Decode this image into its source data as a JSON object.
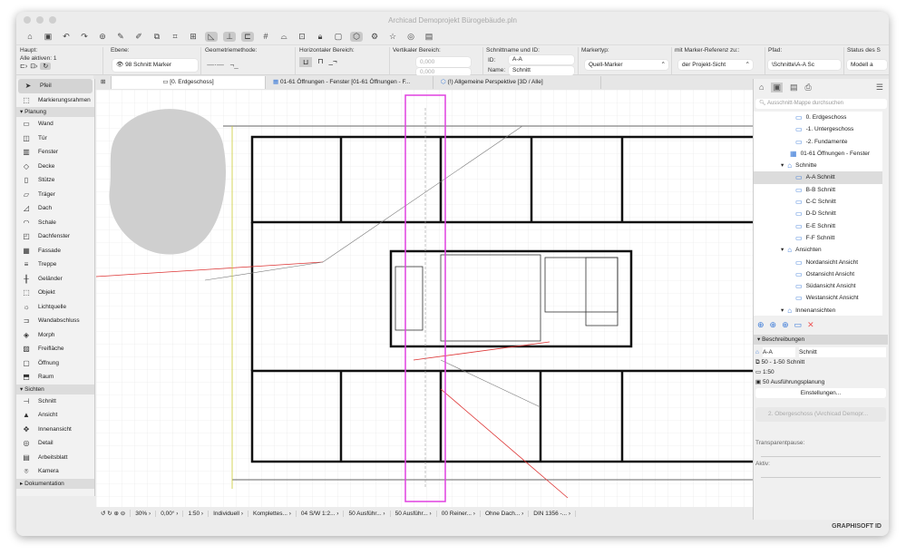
{
  "window": {
    "title": "Archicad Demoprojekt Bürogebäude.pln"
  },
  "infobox": {
    "haupt_label": "Haupt:",
    "alle_aktiven": "Alle aktiven: 1",
    "ebene_label": "Ebene:",
    "ebene_value": "98 Schnitt Marker",
    "geometrie_label": "Geometriemethode:",
    "horizontal_label": "Horizontaler Bereich:",
    "vertikal_label": "Vertikaler Bereich:",
    "vert_value1": "0,000",
    "vert_value2": "0,000",
    "schnitt_label": "Schnittname und ID:",
    "id_label": "ID:",
    "id_value": "A-A",
    "name_label": "Name:",
    "name_value": "Schnitt",
    "markertyp_label": "Markertyp:",
    "markertyp_value": "Quell-Marker",
    "referenz_label": "mit Marker-Referenz zu::",
    "referenz_value": "der Projekt-Sicht",
    "pfad_label": "Pfad:",
    "pfad_value": "\\Schnitte\\A-A Sc",
    "status_label": "Status des S",
    "status_value": "Modell a"
  },
  "tabs": [
    "[0. Erdgeschoss]",
    "01-61 Öffnungen - Fenster [01-61 Öffnungen - F...",
    "(!) Allgemeine Perspektive [3D / Alle]"
  ],
  "toolbox": {
    "tools1": [
      {
        "label": "Pfeil",
        "icon": "arrow"
      },
      {
        "label": "Markierungsrahmen",
        "icon": "marquee"
      }
    ],
    "section1": "Planung",
    "tools2": [
      "Wand",
      "Tür",
      "Fenster",
      "Decke",
      "Stütze",
      "Träger",
      "Dach",
      "Schale",
      "Dachfenster",
      "Fassade",
      "Treppe",
      "Geländer",
      "Objekt",
      "Lichtquelle",
      "Wandabschluss",
      "Morph",
      "Freifläche",
      "Öffnung",
      "Raum"
    ],
    "section2": "Sichten",
    "tools3": [
      "Schnitt",
      "Ansicht",
      "Innenansicht",
      "Detail",
      "Arbeitsblatt",
      "Kamera"
    ],
    "section3": "Dokumentation"
  },
  "navigator": {
    "search_placeholder": "Ausschnitt-Mappe durchsuchen",
    "items": [
      {
        "label": "0. Erdgeschoss",
        "level": 3
      },
      {
        "label": "-1. Untergeschoss",
        "level": 3
      },
      {
        "label": "-2. Fundamente",
        "level": 3
      },
      {
        "label": "01-61 Öffnungen - Fenster",
        "level": 2
      },
      {
        "label": "Schnitte",
        "level": 1
      },
      {
        "label": "A-A Schnitt",
        "level": 3,
        "selected": true
      },
      {
        "label": "B-B Schnitt",
        "level": 3
      },
      {
        "label": "C-C Schnitt",
        "level": 3
      },
      {
        "label": "D-D Schnitt",
        "level": 3
      },
      {
        "label": "E-E Schnitt",
        "level": 3
      },
      {
        "label": "F-F Schnitt",
        "level": 3
      },
      {
        "label": "Ansichten",
        "level": 1
      },
      {
        "label": "Nordansicht Ansicht",
        "level": 3
      },
      {
        "label": "Ostansicht Ansicht",
        "level": 3
      },
      {
        "label": "Südansicht Ansicht",
        "level": 3
      },
      {
        "label": "Westansicht Ansicht",
        "level": 3
      },
      {
        "label": "Innenansichten",
        "level": 1
      }
    ],
    "beschreibungen": "Beschreibungen",
    "id": "A-A",
    "name": "Schnitt",
    "row1": "50 - 1-50 Schnitt",
    "row2": "1:50",
    "row3": "50 Ausführungsplanung",
    "settings_button": "Einstellungen...",
    "source": "2. Obergeschoss (\\Archicad Demopr...",
    "transparent_label": "Transparentpause:",
    "aktiv_label": "Aktiv:"
  },
  "statusbar": [
    "30%",
    "0,00°",
    "1:50",
    "Individuell",
    "Komplettes...",
    "04 S/W 1:2...",
    "50 Ausführ...",
    "50 Ausführ...",
    "00 Reiner...",
    "Ohne Dach...",
    "DIN 1356 -..."
  ],
  "footer": {
    "brand": "GRAPHISOFT ID"
  },
  "colors": {
    "section_line": "#e040e0",
    "accent": "#3a7ad8"
  }
}
